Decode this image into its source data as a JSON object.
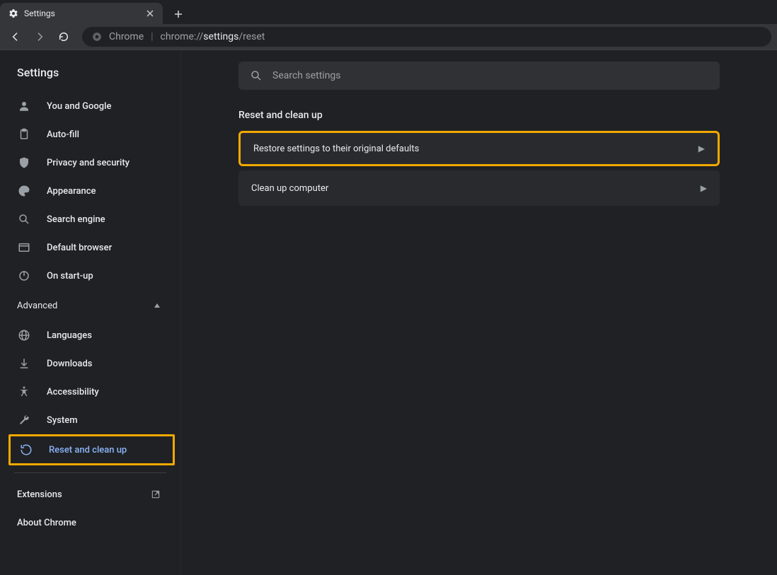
{
  "tab": {
    "title": "Settings"
  },
  "omnibox": {
    "chrome_label": "Chrome",
    "url_prefix": "chrome://",
    "url_bold": "settings",
    "url_suffix": "/reset"
  },
  "sidebar": {
    "title": "Settings",
    "items": [
      {
        "label": "You and Google"
      },
      {
        "label": "Auto-fill"
      },
      {
        "label": "Privacy and security"
      },
      {
        "label": "Appearance"
      },
      {
        "label": "Search engine"
      },
      {
        "label": "Default browser"
      },
      {
        "label": "On start-up"
      }
    ],
    "advanced_label": "Advanced",
    "adv_items": [
      {
        "label": "Languages"
      },
      {
        "label": "Downloads"
      },
      {
        "label": "Accessibility"
      },
      {
        "label": "System"
      },
      {
        "label": "Reset and clean up"
      }
    ],
    "extensions_label": "Extensions",
    "about_label": "About Chrome"
  },
  "main": {
    "search_placeholder": "Search settings",
    "section_title": "Reset and clean up",
    "cards": [
      {
        "label": "Restore settings to their original defaults"
      },
      {
        "label": "Clean up computer"
      }
    ]
  }
}
